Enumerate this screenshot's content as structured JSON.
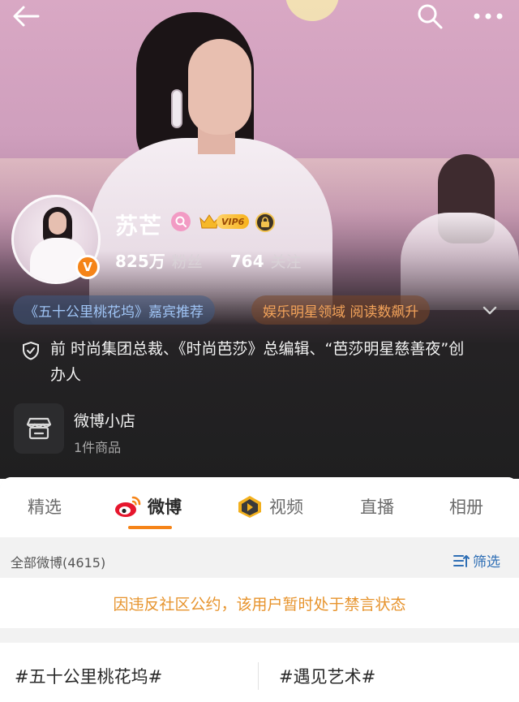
{
  "header": {
    "back_icon": "back-arrow-icon",
    "search_icon": "search-icon",
    "more_icon": "more-dots-icon"
  },
  "profile": {
    "name": "苏芒",
    "vip_label": "VIP6",
    "verified_badge": "V",
    "followers_count": "825万",
    "followers_label": "粉丝",
    "following_count": "764",
    "following_label": "关注"
  },
  "tags": {
    "tag1": "《五十公里桃花坞》嘉宾推荐",
    "tag2": "娱乐明星领域 阅读数飙升"
  },
  "bio": {
    "text": "前 时尚集团总裁、《时尚芭莎》总编辑、“芭莎明星慈善夜”创办人"
  },
  "shop": {
    "title": "微博小店",
    "subtitle": "1件商品"
  },
  "tabs": [
    {
      "label": "精选"
    },
    {
      "label": "微博"
    },
    {
      "label": "视频"
    },
    {
      "label": "直播"
    },
    {
      "label": "相册"
    }
  ],
  "filter": {
    "all_label": "全部微博(4615)",
    "filter_label": "筛选"
  },
  "notice": {
    "text": "因违反社区公约，该用户暂时处于禁言状态"
  },
  "topics": [
    {
      "label": "#五十公里桃花坞#"
    },
    {
      "label": "#遇见艺术#"
    }
  ],
  "colors": {
    "accent_orange": "#f58418",
    "notice_text": "#e7942e",
    "link_blue": "#2f6fb5",
    "dark_bg": "#1f1f20"
  }
}
